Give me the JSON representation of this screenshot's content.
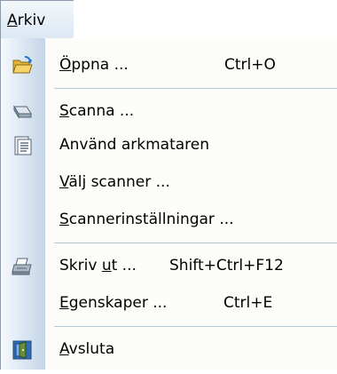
{
  "menubar": {
    "title_u": "A",
    "title_rest": "rkiv"
  },
  "menu": {
    "items": [
      {
        "u": "Ö",
        "rest": "ppna ...",
        "shortcut": "Ctrl+O",
        "icon": "open-folder-icon"
      },
      {
        "u": "S",
        "rest": "canna ...",
        "icon": "scanner-icon"
      },
      {
        "plain": "Använd arkmataren",
        "icon": "document-feeder-icon"
      },
      {
        "u": "V",
        "rest": "älj scanner ...",
        "icon": ""
      },
      {
        "u": "S",
        "rest": "cannerinställningar ...",
        "icon": ""
      },
      {
        "pre": "Skriv ",
        "u": "u",
        "rest": "t ...",
        "shortcut": "Shift+Ctrl+F12",
        "icon": "printer-icon"
      },
      {
        "u": "E",
        "rest": "genskaper ...",
        "shortcut": "Ctrl+E",
        "icon": ""
      },
      {
        "u": "A",
        "rest": "vsluta",
        "icon": "exit-icon"
      }
    ]
  },
  "colors": {
    "gutter_start": "#f6f9fc",
    "gutter_end": "#c3d5e8",
    "border": "#8a9aab",
    "separator": "#b9c7d4"
  }
}
